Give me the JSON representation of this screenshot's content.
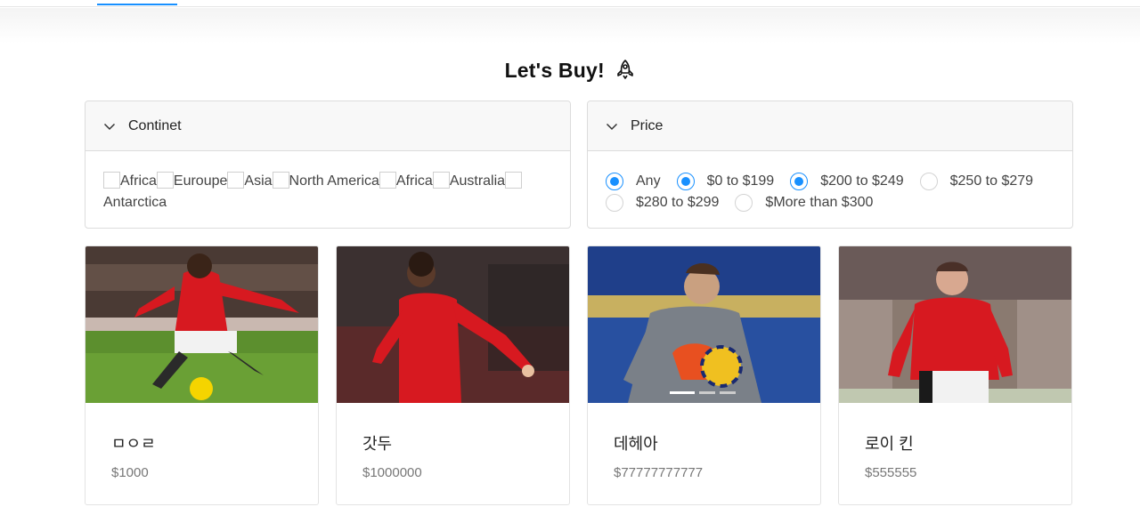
{
  "header": {
    "title": "Let's Buy!",
    "title_icon": "rocket-icon"
  },
  "filters": {
    "continent": {
      "label": "Continet",
      "options": [
        "Africa",
        "Euroupe",
        "Asia",
        "North America",
        "Africa",
        "Australia",
        "Antarctica"
      ]
    },
    "price": {
      "label": "Price",
      "options": [
        {
          "label": "Any",
          "checked": true
        },
        {
          "label": "$0 to $199",
          "checked": true
        },
        {
          "label": "$200 to $249",
          "checked": true
        },
        {
          "label": "$250 to $279",
          "checked": false
        },
        {
          "label": "$280 to $299",
          "checked": false
        },
        {
          "label": "$More than $300",
          "checked": false
        }
      ]
    }
  },
  "products": [
    {
      "name": "ㅁㅇㄹ",
      "price": "$1000"
    },
    {
      "name": "갓두",
      "price": "$1000000"
    },
    {
      "name": "데헤아",
      "price": "$77777777777"
    },
    {
      "name": "로이 킨",
      "price": "$555555"
    }
  ],
  "colors": {
    "accent": "#1890ff",
    "jersey_red": "#d71920",
    "keeper_grey": "#7a8088"
  }
}
